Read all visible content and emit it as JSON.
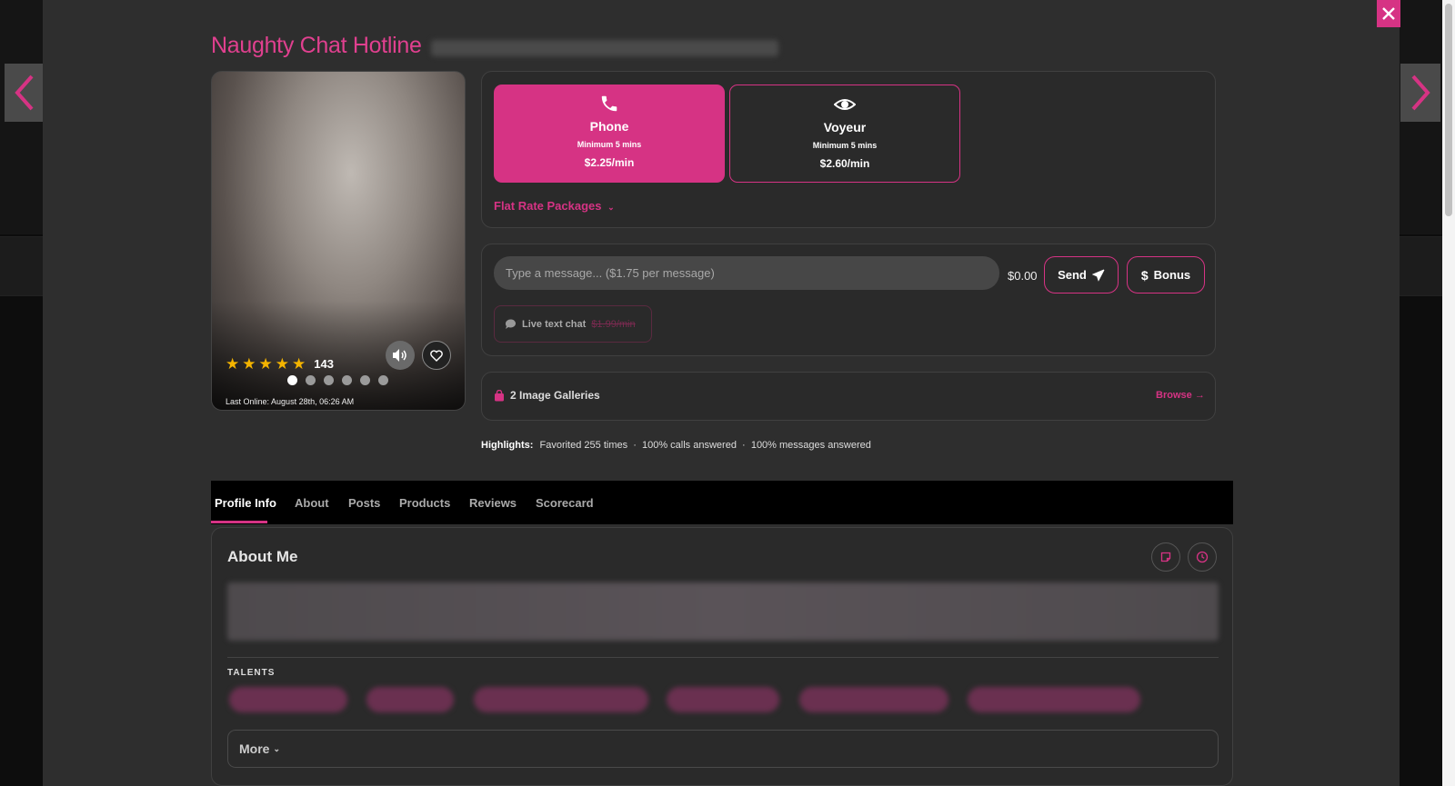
{
  "profile": {
    "title": "Naughty Chat Hotline",
    "rating_count": "143",
    "last_online_label": "Last Online:",
    "last_online_value": "August 28th, 06:26 AM",
    "stars": 5,
    "photo_count": 6
  },
  "services": {
    "phone": {
      "name": "Phone",
      "minimum": "Minimum 5 mins",
      "price": "$2.25/min"
    },
    "voyeur": {
      "name": "Voyeur",
      "minimum": "Minimum 5 mins",
      "price": "$2.60/min"
    },
    "flat_rate_label": "Flat Rate Packages"
  },
  "message": {
    "placeholder": "Type a message... ($1.75 per message)",
    "cost": "$0.00",
    "send_label": "Send",
    "bonus_label": "Bonus",
    "live_chat_label": "Live text chat",
    "live_chat_price": "$1.99/min"
  },
  "galleries": {
    "label": "2 Image Galleries",
    "browse_label": "Browse"
  },
  "highlights": {
    "label": "Highlights:",
    "text": "Favorited 255 times  ·  100% calls answered  ·  100% messages answered"
  },
  "tabs": [
    {
      "label": "Profile Info"
    },
    {
      "label": "About"
    },
    {
      "label": "Posts"
    },
    {
      "label": "Products"
    },
    {
      "label": "Reviews"
    },
    {
      "label": "Scorecard"
    }
  ],
  "about": {
    "title": "About Me",
    "talents_label": "TALENTS",
    "more_label": "More"
  },
  "colors": {
    "accent": "#d63384",
    "title": "#e0408f",
    "star": "#f4b400"
  }
}
